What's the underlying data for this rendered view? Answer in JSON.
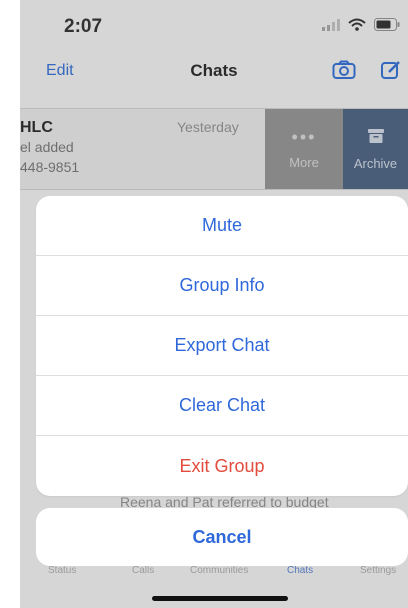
{
  "status_bar": {
    "time": "2:07"
  },
  "nav": {
    "edit_label": "Edit",
    "title": "Chats"
  },
  "chat_row": {
    "name": "HLC",
    "line1": "el added",
    "line2": "448-9851",
    "time": "Yesterday",
    "more_label": "More",
    "archive_label": "Archive"
  },
  "background": {
    "preview_text": "Reena and Pat referred to budget"
  },
  "tabs": [
    {
      "label": "Status"
    },
    {
      "label": "Calls"
    },
    {
      "label": "Communities"
    },
    {
      "label": "Chats"
    },
    {
      "label": "Settings"
    }
  ],
  "action_sheet": {
    "items": [
      {
        "label": "Mute"
      },
      {
        "label": "Group Info"
      },
      {
        "label": "Export Chat"
      },
      {
        "label": "Clear Chat"
      },
      {
        "label": "Exit Group"
      }
    ],
    "cancel_label": "Cancel"
  },
  "colors": {
    "accent": "#2f68da",
    "danger": "#e24b3d",
    "archive_bg": "#3a5579",
    "more_bg": "#8c8c8c"
  }
}
